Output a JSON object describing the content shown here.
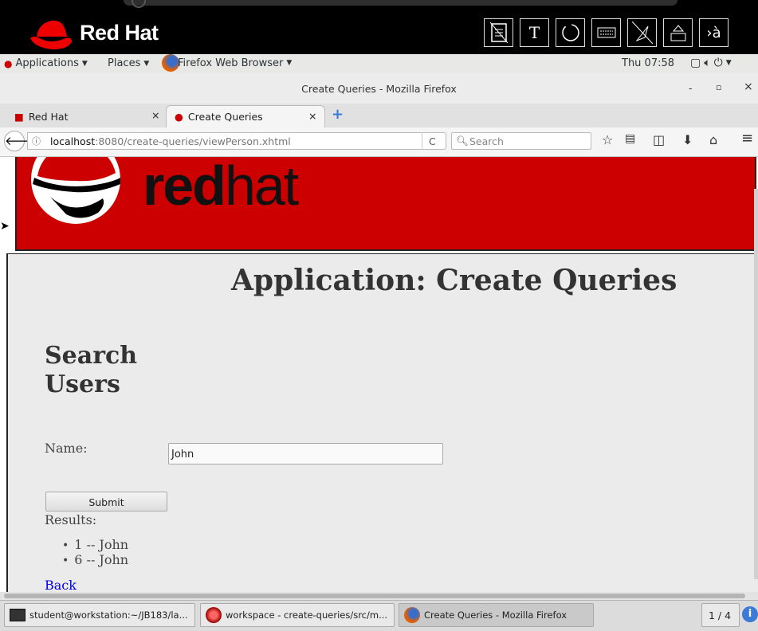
{
  "overlay": {
    "brand": "Red Hat",
    "tools": [
      "doc-icon",
      "T",
      "circle-icon",
      "keyboard-icon",
      "slash-icon",
      "eject-icon",
      "›à"
    ]
  },
  "gnome": {
    "applications": "Applications",
    "places": "Places",
    "active_app": "Firefox Web Browser",
    "clock": "Thu 07:58"
  },
  "window": {
    "title": "Create Queries - Mozilla Firefox",
    "minimize": "-",
    "maximize": "▫",
    "close": "×"
  },
  "tabs": [
    {
      "label": "Red Hat",
      "close": "×"
    },
    {
      "label": "Create Queries",
      "close": "×"
    }
  ],
  "new_tab": "+",
  "nav": {
    "url_host": "localhost",
    "url_rest": ":8080/create-queries/viewPerson.xhtml",
    "search_placeholder": "Search",
    "reload": "C"
  },
  "page": {
    "banner_text_bold": "red",
    "banner_text_light": "hat",
    "title": "Application: Create Queries",
    "heading": "Search Users",
    "name_label": "Name:",
    "name_value": "John",
    "submit": "Submit",
    "results_label": "Results:",
    "results": [
      "1 -- John",
      "6 -- John"
    ],
    "back": "Back"
  },
  "taskbar": {
    "items": [
      "student@workstation:~/JB183/la...",
      "workspace - create-queries/src/m...",
      "Create Queries - Mozilla Firefox"
    ],
    "pager": "1 / 4",
    "info": "i"
  },
  "colors": {
    "banner": "#cc0000",
    "link": "#0000ee"
  }
}
